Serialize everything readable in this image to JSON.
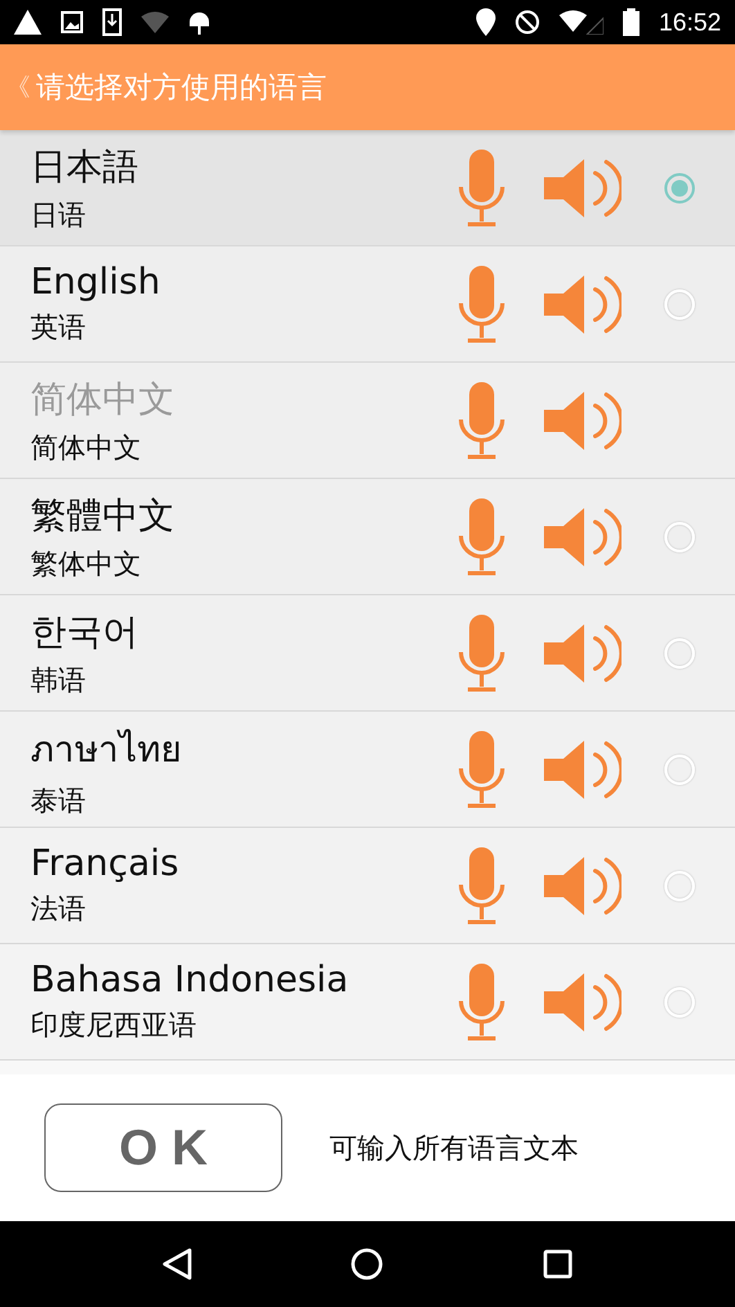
{
  "status_bar": {
    "time": "16:52"
  },
  "header": {
    "back": "《",
    "title": "请选择对方使用的语言"
  },
  "languages": [
    {
      "name": "日本語",
      "translation": "日语",
      "disabled": false,
      "selected": true
    },
    {
      "name": "English",
      "translation": "英语",
      "disabled": false,
      "selected": false
    },
    {
      "name": "简体中文",
      "translation": "简体中文",
      "disabled": true,
      "selected": false
    },
    {
      "name": "繁體中文",
      "translation": "繁体中文",
      "disabled": false,
      "selected": false
    },
    {
      "name": "한국어",
      "translation": "韩语",
      "disabled": false,
      "selected": false
    },
    {
      "name": "ภาษาไทย",
      "translation": "泰语",
      "disabled": false,
      "selected": false
    },
    {
      "name": "Français",
      "translation": "法语",
      "disabled": false,
      "selected": false
    },
    {
      "name": "Bahasa Indonesia",
      "translation": "印度尼西亚语",
      "disabled": false,
      "selected": false
    }
  ],
  "footer": {
    "ok_button": "O K",
    "hint": "可输入所有语言文本"
  }
}
